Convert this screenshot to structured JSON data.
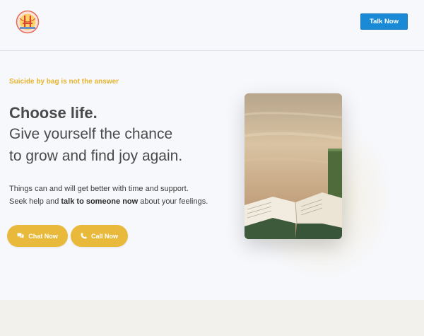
{
  "header": {
    "logo_icon": "golden-gate-bridge-logo-icon",
    "talk_button_label": "Talk Now",
    "accent_color": "#1b8ad6"
  },
  "hero": {
    "tagline": "Suicide by bag is not the answer",
    "headline_strong": "Choose life.",
    "headline_line2": "Give yourself the chance",
    "headline_line3": "to grow and find joy again.",
    "body_line1": "Things can and will get better with time and support.",
    "body_line2_prefix": "Seek help and ",
    "body_line2_bold": "talk to someone now",
    "body_line2_suffix": " about your feelings.",
    "accent_color": "#e8b93a"
  },
  "actions": {
    "chat_label": "Chat Now",
    "chat_icon": "chat-bubbles-icon",
    "call_label": "Call Now",
    "call_icon": "phone-icon"
  },
  "image": {
    "subject": "open-book-and-mug-photo"
  }
}
